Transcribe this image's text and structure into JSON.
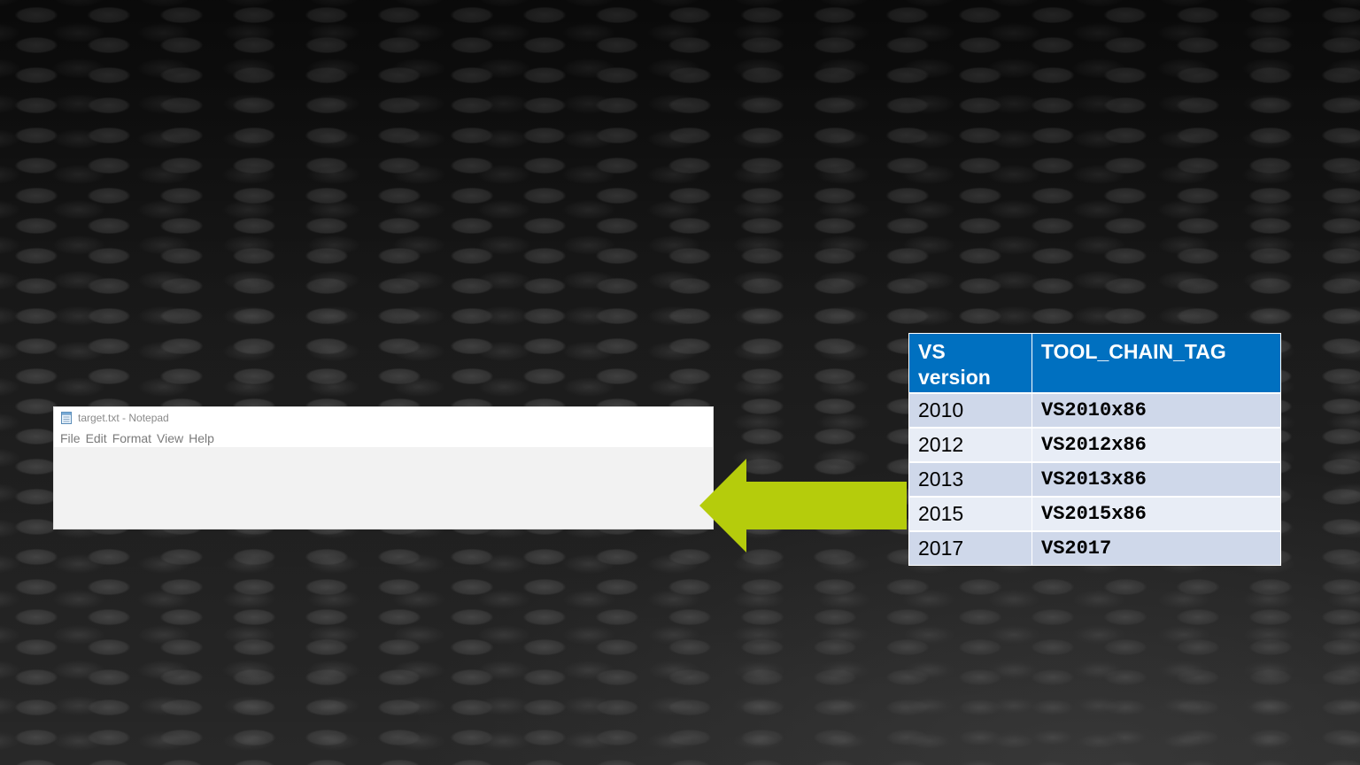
{
  "notepad": {
    "title": "target.txt - Notepad",
    "menu": [
      "File",
      "Edit",
      "Format",
      "View",
      "Help"
    ]
  },
  "arrow": {
    "color": "#b5cc0c",
    "direction": "left"
  },
  "table": {
    "header_color": "#0070c0",
    "headers": [
      "VS version",
      "TOOL_CHAIN_TAG"
    ],
    "rows": [
      {
        "version": "2010",
        "tag": "VS2010x86"
      },
      {
        "version": "2012",
        "tag": "VS2012x86"
      },
      {
        "version": "2013",
        "tag": "VS2013x86"
      },
      {
        "version": "2015",
        "tag": "VS2015x86"
      },
      {
        "version": "2017",
        "tag": "VS2017"
      }
    ]
  }
}
